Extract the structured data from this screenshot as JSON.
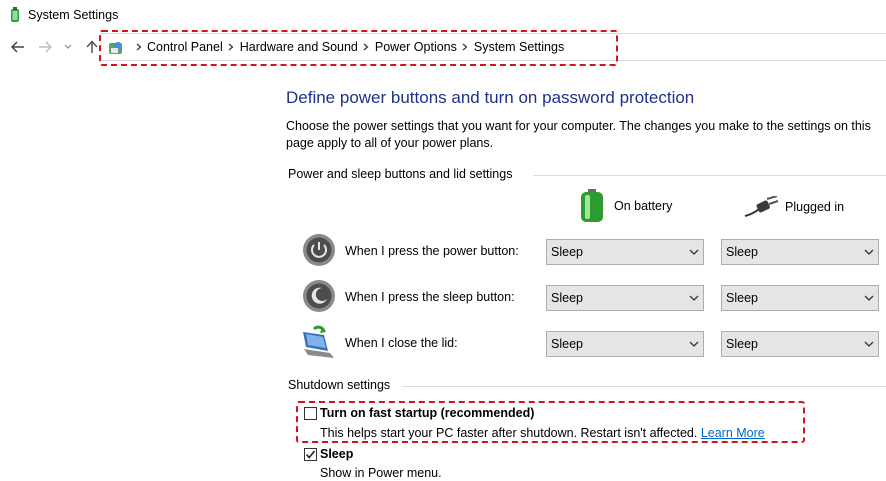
{
  "window": {
    "title": "System Settings"
  },
  "breadcrumb": [
    "Control Panel",
    "Hardware and Sound",
    "Power Options",
    "System Settings"
  ],
  "heading": "Define power buttons and turn on password protection",
  "description": "Choose the power settings that you want for your computer. The changes you make to the settings on this page apply to all of your power plans.",
  "power_section": {
    "label": "Power and sleep buttons and lid settings",
    "columns": {
      "battery": "On battery",
      "plugged": "Plugged in"
    },
    "rows": [
      {
        "label": "When I press the power button:",
        "battery": "Sleep",
        "plugged": "Sleep",
        "icon": "power-button-icon"
      },
      {
        "label": "When I press the sleep button:",
        "battery": "Sleep",
        "plugged": "Sleep",
        "icon": "sleep-button-icon"
      },
      {
        "label": "When I close the lid:",
        "battery": "Sleep",
        "plugged": "Sleep",
        "icon": "laptop-lid-icon"
      }
    ]
  },
  "shutdown_section": {
    "label": "Shutdown settings",
    "fast_startup": {
      "label": "Turn on fast startup (recommended)",
      "description": "This helps start your PC faster after shutdown. Restart isn't affected.",
      "link": "Learn More",
      "checked": false
    },
    "sleep": {
      "label": "Sleep",
      "description": "Show in Power menu.",
      "checked": true
    }
  },
  "colors": {
    "heading": "#1e3287",
    "link": "#0066cc",
    "highlight": "#d4141c"
  }
}
